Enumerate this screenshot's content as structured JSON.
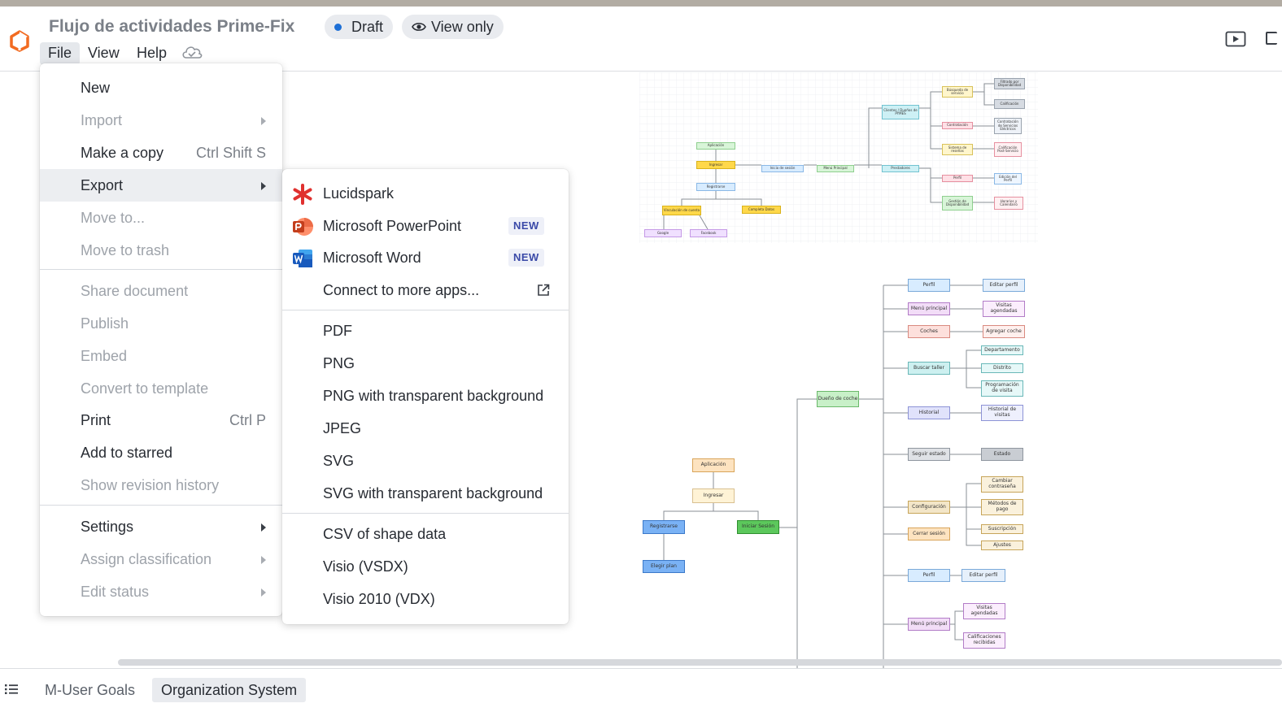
{
  "header": {
    "title": "Flujo de actividades Prime-Fix",
    "status_badge": "Draft",
    "access_badge": "View only",
    "menubar": [
      "File",
      "View",
      "Help"
    ]
  },
  "file_menu": {
    "new": "New",
    "import": "Import",
    "make_copy": "Make a copy",
    "make_copy_shortcut": "Ctrl Shift S",
    "export": "Export",
    "move_to": "Move to...",
    "move_to_trash": "Move to trash",
    "share_document": "Share document",
    "publish": "Publish",
    "embed": "Embed",
    "convert_to_template": "Convert to template",
    "print": "Print",
    "print_shortcut": "Ctrl P",
    "add_to_starred": "Add to starred",
    "show_revision_history": "Show revision history",
    "settings": "Settings",
    "assign_classification": "Assign classification",
    "edit_status": "Edit status"
  },
  "export_menu": {
    "lucidspark": "Lucidspark",
    "powerpoint": "Microsoft PowerPoint",
    "word": "Microsoft Word",
    "new_badge": "NEW",
    "connect_more": "Connect to more apps...",
    "pdf": "PDF",
    "png": "PNG",
    "png_transparent": "PNG with transparent background",
    "jpeg": "JPEG",
    "svg": "SVG",
    "svg_transparent": "SVG with transparent background",
    "csv": "CSV of shape data",
    "visio_vsdx": "Visio (VSDX)",
    "visio_vdx": "Visio 2010 (VDX)"
  },
  "canvas": {
    "diagram1_nodes": [
      "Aplicación",
      "Ingresar",
      "Registrarse",
      "Vinculación de cuenta",
      "Completa Datos",
      "Google",
      "Facebook",
      "Inicio de sesión",
      "Menú Principal",
      "Clientes / Dueños de PYMES",
      "Búsqueda de servicio",
      "Contratación",
      "Sistema de reseñas",
      "Perfil",
      "Gestión de Disponibilidad",
      "Filtrado por Disponibilidad",
      "Calificación",
      "Contratación de Servicios Eléctricos",
      "Calificación Post-Servicio",
      "Edición del Perfil",
      "Horarios y Calendario",
      "Prestadores"
    ],
    "diagram2_nodes": [
      "Aplicación",
      "Ingresar",
      "Registrarse",
      "Iniciar Sesión",
      "Elegir plan",
      "Dueño de coche",
      "Perfil",
      "Menú principal",
      "Coches",
      "Buscar taller",
      "Historial",
      "Seguir estado",
      "Configuración",
      "Cerrar sesión",
      "Editar perfil",
      "Visitas agendadas",
      "Agregar coche",
      "Departamento",
      "Distrito",
      "Programación de visita",
      "Historial de visitas",
      "Estado",
      "Cambiar contraseña",
      "Métodos de pago",
      "Suscripción",
      "Ajustes"
    ],
    "diagram3_nodes": [
      "Perfil",
      "Editar perfil",
      "Menú principal",
      "Visitas agendadas",
      "Calificaciones recibidas"
    ]
  },
  "bottom_tabs": [
    "M-User Goals",
    "Organization System"
  ],
  "colors": {
    "brand_orange": "#f26b21",
    "draft_dot": "#1d6fd6",
    "menu_active": "#eceef1",
    "new_badge_text": "#3b4aa8"
  },
  "icons": {
    "logo": "lucid-logo-icon",
    "view_only": "eye-icon",
    "cloud": "cloud-saved-icon",
    "present": "present-play-icon",
    "lucidspark": "lucidspark-asterisk-icon",
    "powerpoint": "powerpoint-icon",
    "word": "word-icon",
    "connect": "external-link-icon",
    "pages": "pages-list-icon"
  }
}
